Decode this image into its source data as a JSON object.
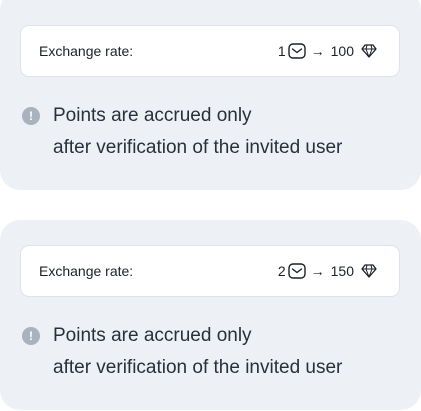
{
  "cards": [
    {
      "rate_label": "Exchange rate:",
      "rate_from": "1",
      "currency_icon": "envelope-icon",
      "arrow": "→",
      "rate_to": "100",
      "points_icon": "diamond-icon",
      "note_line_1": "Points are accrued only",
      "note_line_2": "after verification of the invited user",
      "note_icon_glyph": "!"
    },
    {
      "rate_label": "Exchange rate:",
      "rate_from": "2",
      "currency_icon": "envelope-icon",
      "arrow": "→",
      "rate_to": "150",
      "points_icon": "diamond-icon",
      "note_line_1": "Points are accrued only",
      "note_line_2": "after verification of the invited user",
      "note_icon_glyph": "!"
    }
  ],
  "colors": {
    "card_background": "#edf1f6",
    "rate_box_background": "#ffffff",
    "info_icon": "#a9b2be",
    "text": "#1f2430"
  }
}
